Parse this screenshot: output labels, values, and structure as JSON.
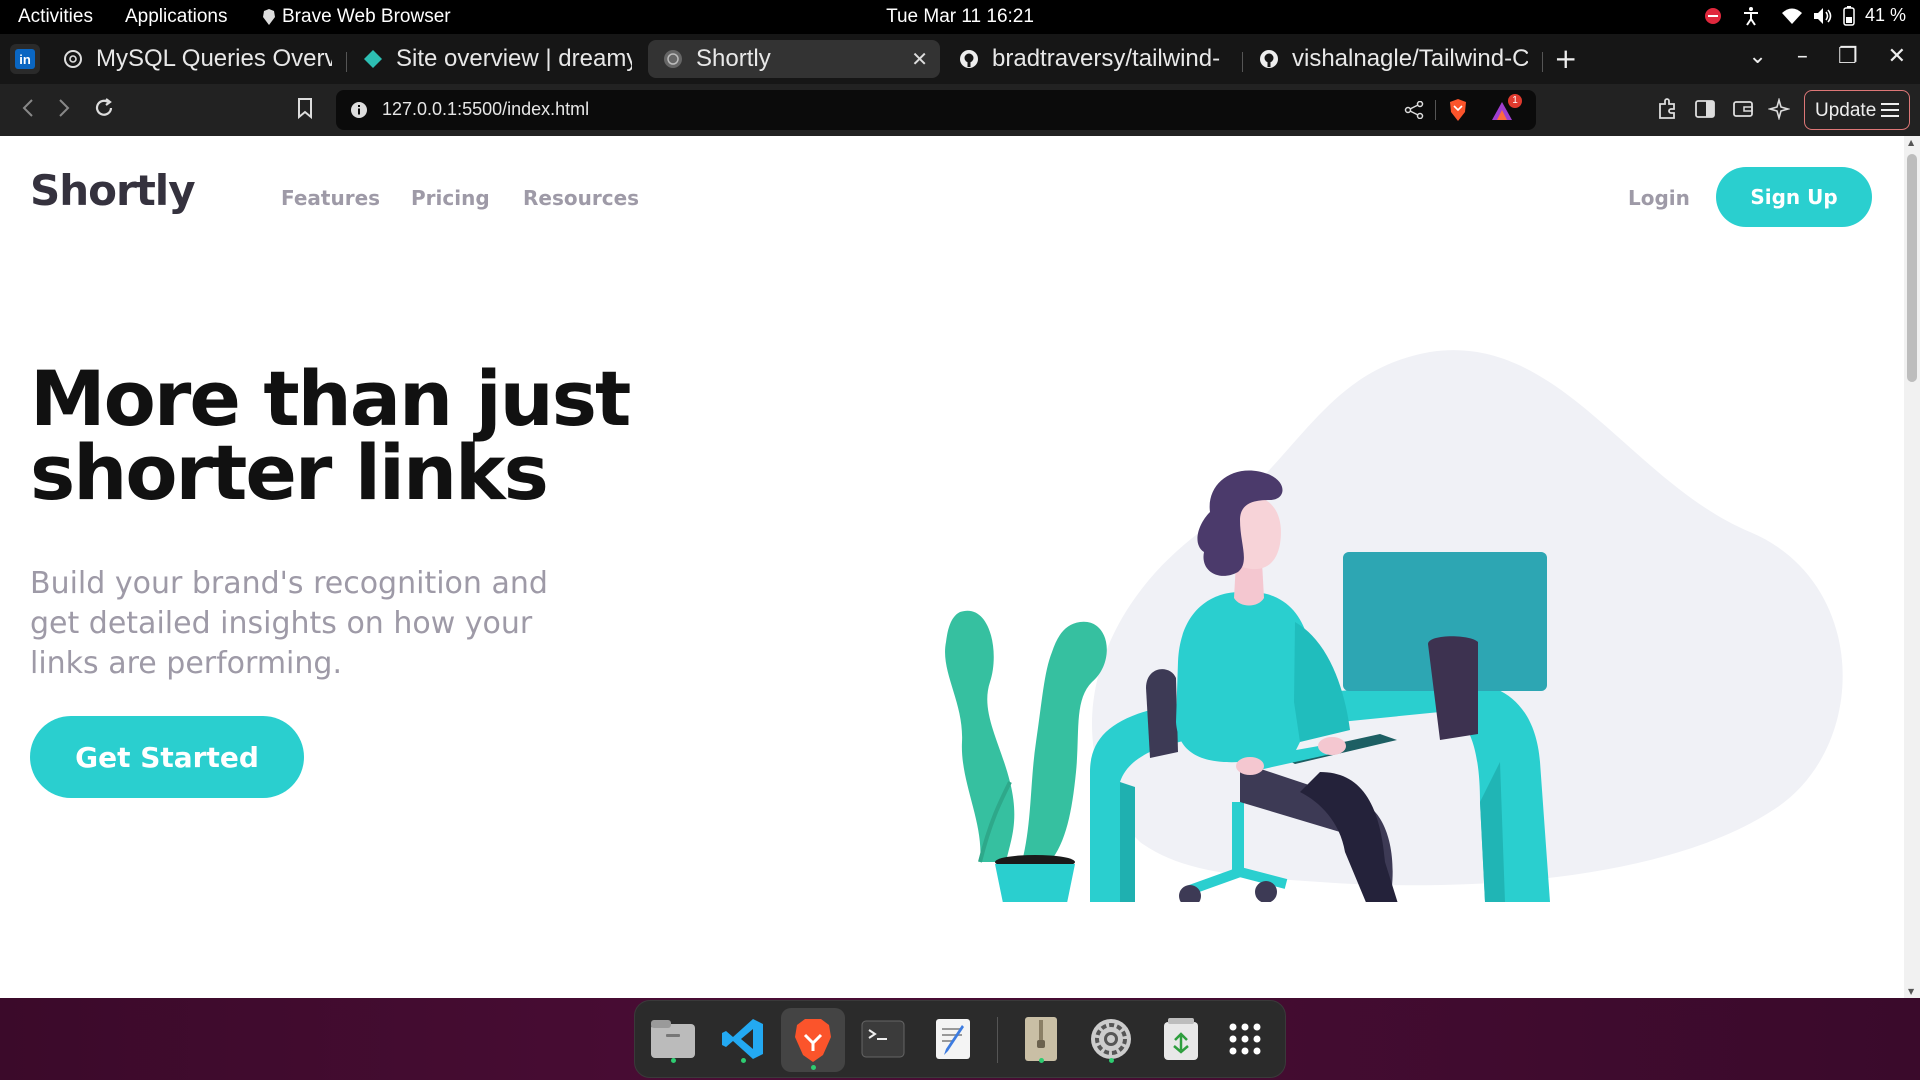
{
  "system_bar": {
    "activities": "Activities",
    "applications": "Applications",
    "active_app": "Brave Web Browser",
    "clock": "Tue Mar 11  16:21",
    "battery": "41 %"
  },
  "browser": {
    "tabs": [
      {
        "title": "MySQL Queries Overv",
        "icon": "chatgpt-icon"
      },
      {
        "title": "Site overview | dreamy",
        "icon": "netlify-icon"
      },
      {
        "title": "Shortly",
        "icon": "globe-icon",
        "active": true
      },
      {
        "title": "bradtraversy/tailwind-",
        "icon": "github-icon"
      },
      {
        "title": "vishalnagle/Tailwind-C",
        "icon": "github-icon"
      }
    ],
    "url": "127.0.0.1:5500/index.html",
    "update_label": "Update",
    "shields_count": "1"
  },
  "page": {
    "logo": "Shortly",
    "nav": {
      "features": "Features",
      "pricing": "Pricing",
      "resources": "Resources"
    },
    "login": "Login",
    "signup": "Sign Up",
    "hero_title_line1": "More than just",
    "hero_title_line2": "shorter links",
    "hero_subtitle": "Build your brand's recognition and get detailed insights on how your links are performing.",
    "cta": "Get Started"
  },
  "dock": {
    "apps": [
      "files-icon",
      "vscode-icon",
      "brave-icon",
      "terminal-icon",
      "text-editor-icon",
      "archive-icon",
      "settings-icon",
      "trash-icon",
      "app-grid-icon"
    ]
  },
  "colors": {
    "accent": "#2acfcf",
    "dark_text": "#35323e",
    "gray_text": "#9e9aa7"
  }
}
